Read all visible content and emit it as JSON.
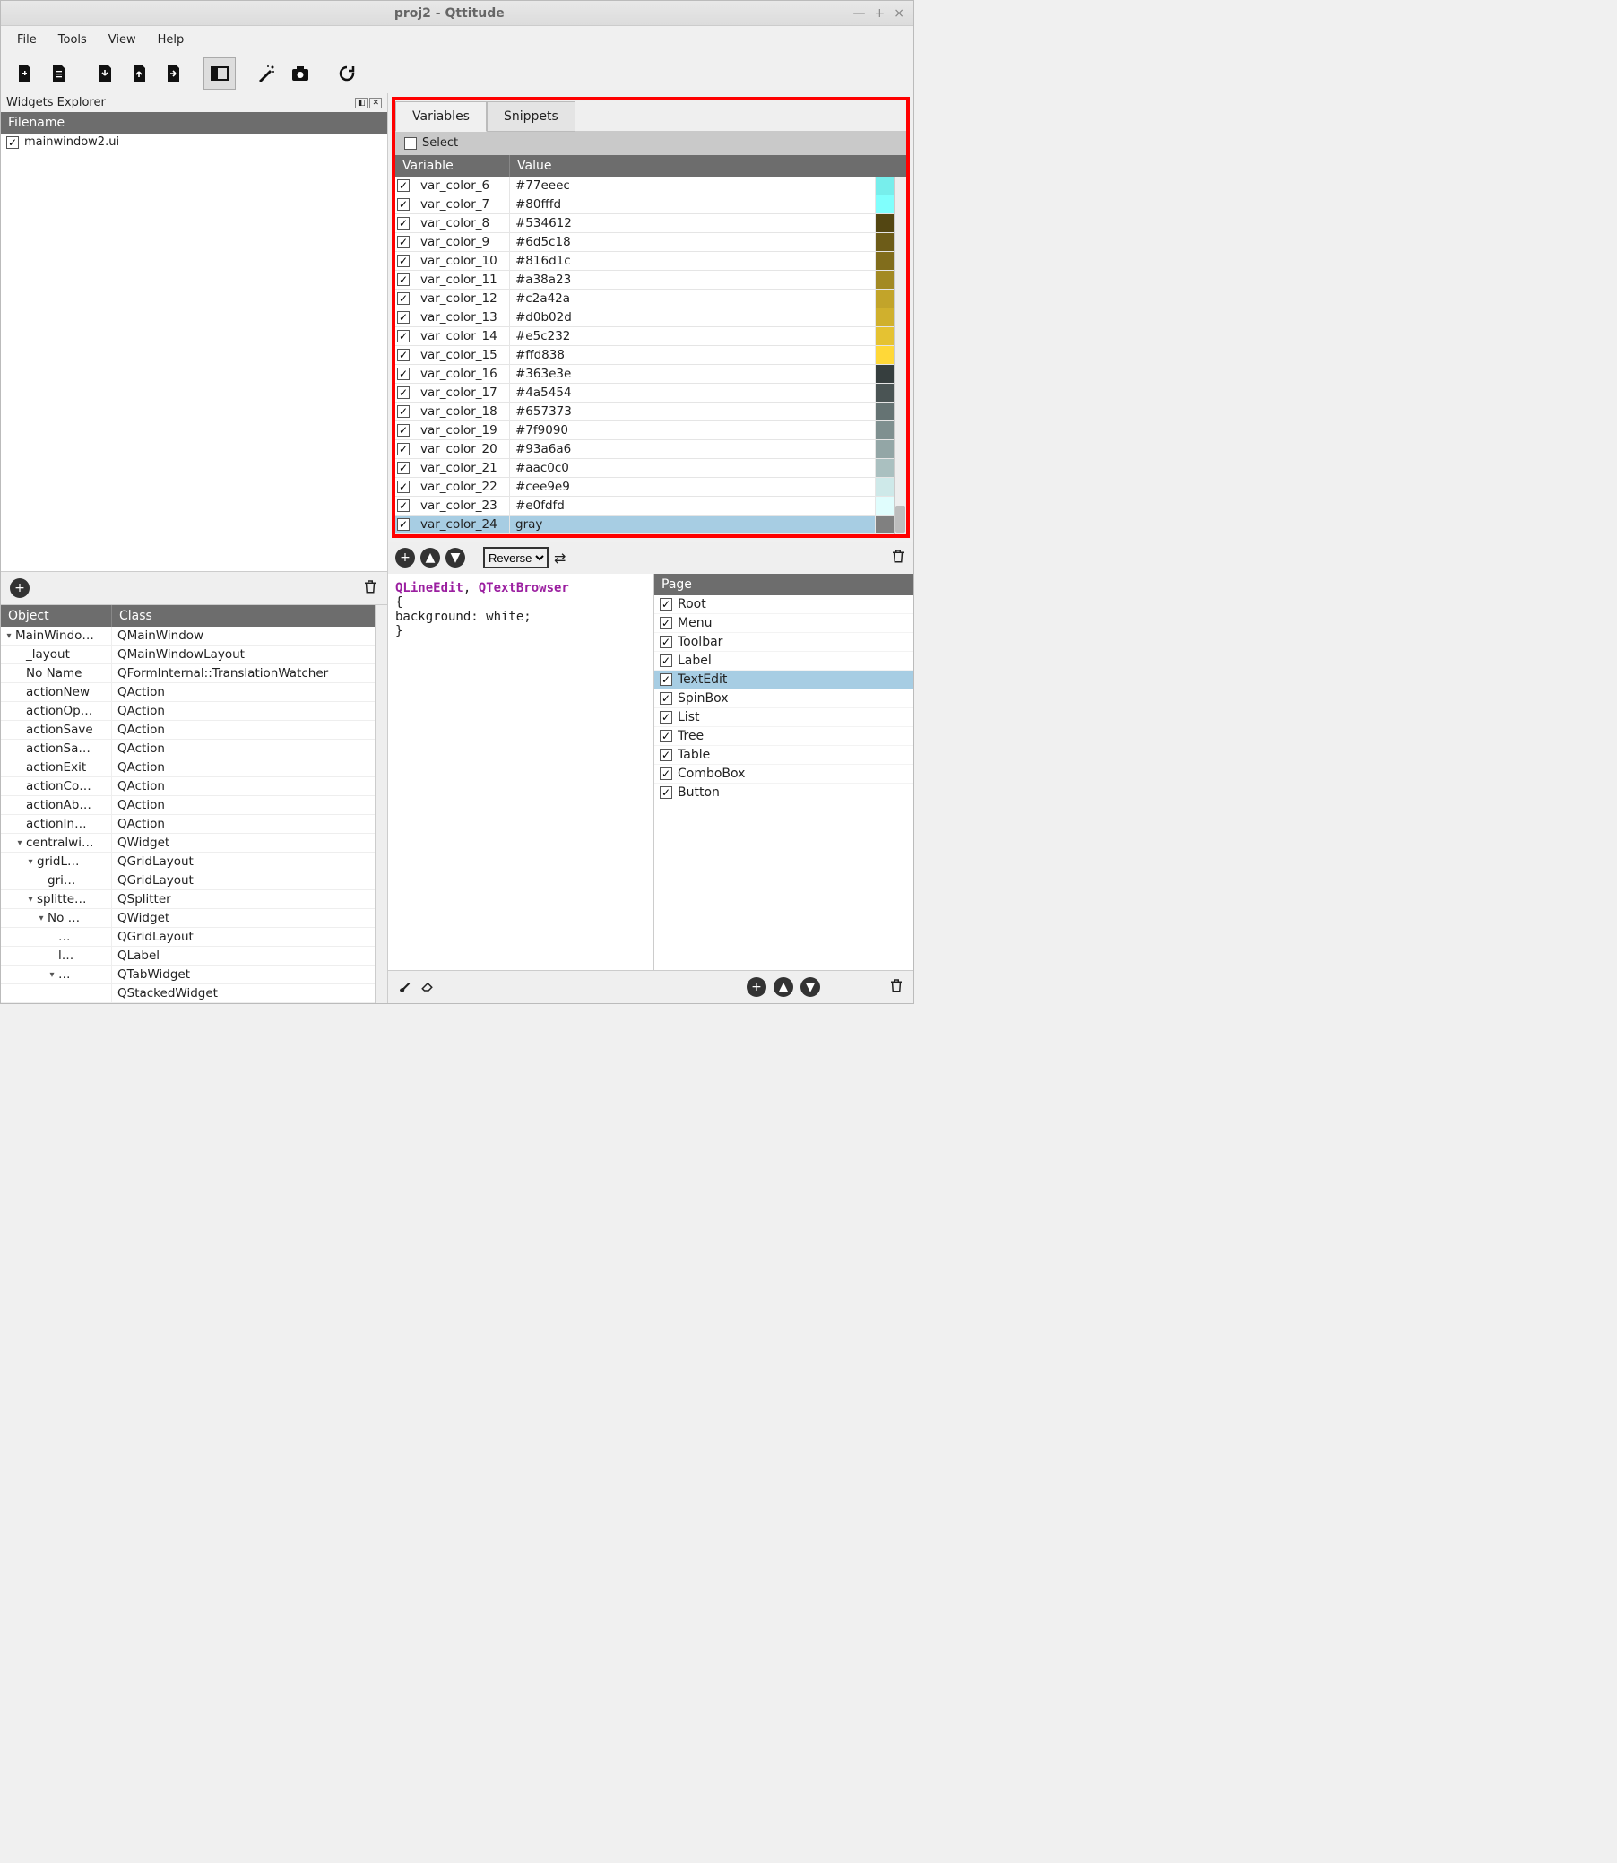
{
  "window": {
    "title": "proj2 - Qttitude"
  },
  "menubar": [
    "File",
    "Tools",
    "View",
    "Help"
  ],
  "widgets_explorer": {
    "title": "Widgets Explorer",
    "header": "Filename",
    "items": [
      {
        "name": "mainwindow2.ui",
        "checked": true
      }
    ]
  },
  "object_tree": {
    "headers": {
      "object": "Object",
      "class": "Class"
    },
    "rows": [
      {
        "indent": 0,
        "arrow": "▾",
        "object": "MainWindo…",
        "class": "QMainWindow"
      },
      {
        "indent": 1,
        "arrow": "",
        "object": "_layout",
        "class": "QMainWindowLayout"
      },
      {
        "indent": 1,
        "arrow": "",
        "object": "No Name",
        "class": "QFormInternal::TranslationWatcher"
      },
      {
        "indent": 1,
        "arrow": "",
        "object": "actionNew",
        "class": "QAction"
      },
      {
        "indent": 1,
        "arrow": "",
        "object": "actionOp…",
        "class": "QAction"
      },
      {
        "indent": 1,
        "arrow": "",
        "object": "actionSave",
        "class": "QAction"
      },
      {
        "indent": 1,
        "arrow": "",
        "object": "actionSa…",
        "class": "QAction"
      },
      {
        "indent": 1,
        "arrow": "",
        "object": "actionExit",
        "class": "QAction"
      },
      {
        "indent": 1,
        "arrow": "",
        "object": "actionCo…",
        "class": "QAction"
      },
      {
        "indent": 1,
        "arrow": "",
        "object": "actionAb…",
        "class": "QAction"
      },
      {
        "indent": 1,
        "arrow": "",
        "object": "actionIn…",
        "class": "QAction"
      },
      {
        "indent": 1,
        "arrow": "▾",
        "object": "centralwi…",
        "class": "QWidget"
      },
      {
        "indent": 2,
        "arrow": "▾",
        "object": "gridL…",
        "class": "QGridLayout"
      },
      {
        "indent": 3,
        "arrow": "",
        "object": "gri…",
        "class": "QGridLayout"
      },
      {
        "indent": 2,
        "arrow": "▾",
        "object": "splitte…",
        "class": "QSplitter"
      },
      {
        "indent": 3,
        "arrow": "▾",
        "object": "No …",
        "class": "QWidget"
      },
      {
        "indent": 4,
        "arrow": "",
        "object": "…",
        "class": "QGridLayout"
      },
      {
        "indent": 4,
        "arrow": "",
        "object": "l…",
        "class": "QLabel"
      },
      {
        "indent": 4,
        "arrow": "▾",
        "object": "…",
        "class": "QTabWidget"
      },
      {
        "indent": 5,
        "arrow": "",
        "object": "",
        "class": "QStackedWidget"
      }
    ]
  },
  "variables_panel": {
    "tabs": {
      "variables": "Variables",
      "snippets": "Snippets",
      "active": "variables"
    },
    "select_all": "Select",
    "headers": {
      "variable": "Variable",
      "value": "Value"
    },
    "rows": [
      {
        "checked": true,
        "name": "var_color_6",
        "value": "#77eeec",
        "swatch": "#77eeec"
      },
      {
        "checked": true,
        "name": "var_color_7",
        "value": "#80fffd",
        "swatch": "#80fffd"
      },
      {
        "checked": true,
        "name": "var_color_8",
        "value": "#534612",
        "swatch": "#534612"
      },
      {
        "checked": true,
        "name": "var_color_9",
        "value": "#6d5c18",
        "swatch": "#6d5c18"
      },
      {
        "checked": true,
        "name": "var_color_10",
        "value": "#816d1c",
        "swatch": "#816d1c"
      },
      {
        "checked": true,
        "name": "var_color_11",
        "value": "#a38a23",
        "swatch": "#a38a23"
      },
      {
        "checked": true,
        "name": "var_color_12",
        "value": "#c2a42a",
        "swatch": "#c2a42a"
      },
      {
        "checked": true,
        "name": "var_color_13",
        "value": "#d0b02d",
        "swatch": "#d0b02d"
      },
      {
        "checked": true,
        "name": "var_color_14",
        "value": "#e5c232",
        "swatch": "#e5c232"
      },
      {
        "checked": true,
        "name": "var_color_15",
        "value": "#ffd838",
        "swatch": "#ffd838"
      },
      {
        "checked": true,
        "name": "var_color_16",
        "value": "#363e3e",
        "swatch": "#363e3e"
      },
      {
        "checked": true,
        "name": "var_color_17",
        "value": "#4a5454",
        "swatch": "#4a5454"
      },
      {
        "checked": true,
        "name": "var_color_18",
        "value": "#657373",
        "swatch": "#657373"
      },
      {
        "checked": true,
        "name": "var_color_19",
        "value": "#7f9090",
        "swatch": "#7f9090"
      },
      {
        "checked": true,
        "name": "var_color_20",
        "value": "#93a6a6",
        "swatch": "#93a6a6"
      },
      {
        "checked": true,
        "name": "var_color_21",
        "value": "#aac0c0",
        "swatch": "#aac0c0"
      },
      {
        "checked": true,
        "name": "var_color_22",
        "value": "#cee9e9",
        "swatch": "#cee9e9"
      },
      {
        "checked": true,
        "name": "var_color_23",
        "value": "#e0fdfd",
        "swatch": "#e0fdfd"
      },
      {
        "checked": true,
        "name": "var_color_24",
        "value": "gray",
        "swatch": "#808080",
        "selected": true
      }
    ]
  },
  "reverse_toolbar": {
    "dropdown": "Reverse"
  },
  "code": {
    "line1_a": "QLineEdit",
    "line1_b": "QTextBrowser",
    "body": "{\nbackground: white;\n}"
  },
  "page_panel": {
    "header": "Page",
    "items": [
      {
        "name": "Root",
        "checked": true
      },
      {
        "name": "Menu",
        "checked": true
      },
      {
        "name": "Toolbar",
        "checked": true
      },
      {
        "name": "Label",
        "checked": true
      },
      {
        "name": "TextEdit",
        "checked": true,
        "selected": true
      },
      {
        "name": "SpinBox",
        "checked": true
      },
      {
        "name": "List",
        "checked": true
      },
      {
        "name": "Tree",
        "checked": true
      },
      {
        "name": "Table",
        "checked": true
      },
      {
        "name": "ComboBox",
        "checked": true
      },
      {
        "name": "Button",
        "checked": true
      }
    ]
  }
}
